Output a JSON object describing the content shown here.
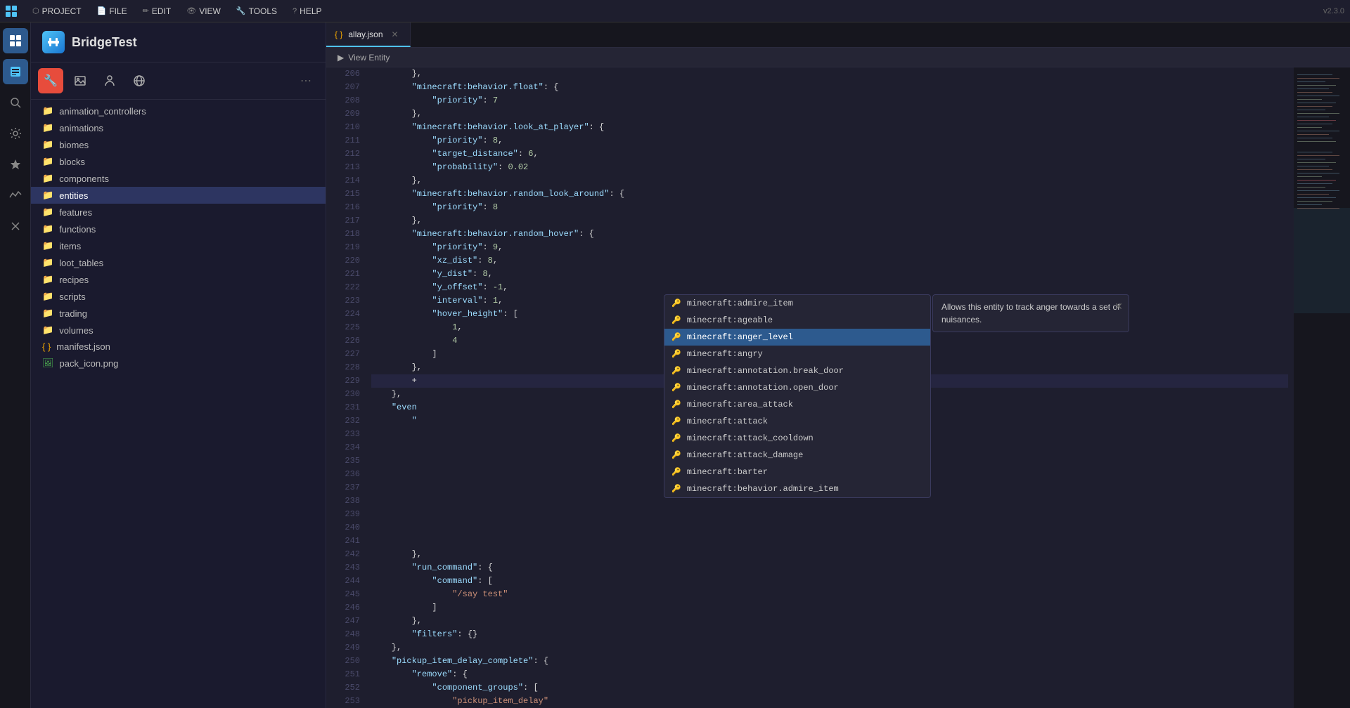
{
  "app": {
    "version": "v2.3.0",
    "title": "BridgeTest"
  },
  "menubar": {
    "items": [
      {
        "id": "project",
        "label": "PROJECT",
        "icon": "⬡"
      },
      {
        "id": "file",
        "label": "FILE",
        "icon": "📄"
      },
      {
        "id": "edit",
        "label": "EDIT",
        "icon": "✏️"
      },
      {
        "id": "view",
        "label": "VIEW",
        "icon": "👁"
      },
      {
        "id": "tools",
        "label": "TOOLS",
        "icon": "🔧"
      },
      {
        "id": "help",
        "label": "HELP",
        "icon": "?"
      }
    ]
  },
  "activity_bar": {
    "icons": [
      {
        "id": "grid",
        "symbol": "⊞",
        "active": true
      },
      {
        "id": "file-explorer",
        "symbol": "📁",
        "active": true
      },
      {
        "id": "search",
        "symbol": "🔍"
      },
      {
        "id": "settings",
        "symbol": "⚙"
      },
      {
        "id": "extensions",
        "symbol": "✦"
      },
      {
        "id": "signal",
        "symbol": "⌇"
      },
      {
        "id": "close",
        "symbol": "✕"
      }
    ]
  },
  "sidebar": {
    "title": "BridgeTest",
    "toolbar": {
      "wrench_btn": "🔧",
      "image_btn": "🖼",
      "person_btn": "🧍",
      "globe_btn": "🌐",
      "more_btn": "⋯"
    },
    "files": [
      {
        "name": "animation_controllers",
        "type": "folder"
      },
      {
        "name": "animations",
        "type": "folder"
      },
      {
        "name": "biomes",
        "type": "folder"
      },
      {
        "name": "blocks",
        "type": "folder"
      },
      {
        "name": "components",
        "type": "folder"
      },
      {
        "name": "entities",
        "type": "folder",
        "active": true
      },
      {
        "name": "features",
        "type": "folder"
      },
      {
        "name": "functions",
        "type": "folder"
      },
      {
        "name": "items",
        "type": "folder"
      },
      {
        "name": "loot_tables",
        "type": "folder"
      },
      {
        "name": "recipes",
        "type": "folder"
      },
      {
        "name": "scripts",
        "type": "folder"
      },
      {
        "name": "trading",
        "type": "folder"
      },
      {
        "name": "volumes",
        "type": "folder"
      },
      {
        "name": "manifest.json",
        "type": "json"
      },
      {
        "name": "pack_icon.png",
        "type": "png"
      }
    ]
  },
  "tab": {
    "filename": "allay.json",
    "icon": "{}",
    "close_btn": "✕"
  },
  "view_entity": {
    "label": "View Entity",
    "arrow": "▶"
  },
  "code": {
    "lines": [
      {
        "num": 206,
        "content": "        },"
      },
      {
        "num": 207,
        "content": "        \"minecraft:behavior.float\": {"
      },
      {
        "num": 208,
        "content": "            \"priority\": 7"
      },
      {
        "num": 209,
        "content": "        },"
      },
      {
        "num": 210,
        "content": "        \"minecraft:behavior.look_at_player\": {"
      },
      {
        "num": 211,
        "content": "            \"priority\": 8,"
      },
      {
        "num": 212,
        "content": "            \"target_distance\": 6,"
      },
      {
        "num": 213,
        "content": "            \"probability\": 0.02"
      },
      {
        "num": 214,
        "content": "        },"
      },
      {
        "num": 215,
        "content": "        \"minecraft:behavior.random_look_around\": {"
      },
      {
        "num": 216,
        "content": "            \"priority\": 8"
      },
      {
        "num": 217,
        "content": "        },"
      },
      {
        "num": 218,
        "content": "        \"minecraft:behavior.random_hover\": {"
      },
      {
        "num": 219,
        "content": "            \"priority\": 9,"
      },
      {
        "num": 220,
        "content": "            \"xz_dist\": 8,"
      },
      {
        "num": 221,
        "content": "            \"y_dist\": 8,"
      },
      {
        "num": 222,
        "content": "            \"y_offset\": -1,"
      },
      {
        "num": 223,
        "content": "            \"interval\": 1,"
      },
      {
        "num": 224,
        "content": "            \"hover_height\": ["
      },
      {
        "num": 225,
        "content": "                1,"
      },
      {
        "num": 226,
        "content": "                4"
      },
      {
        "num": 227,
        "content": "            ]"
      },
      {
        "num": 228,
        "content": "        },"
      },
      {
        "num": 229,
        "content": "        +"
      },
      {
        "num": 230,
        "content": "    },"
      },
      {
        "num": 231,
        "content": "    \"even"
      },
      {
        "num": 232,
        "content": "        \""
      },
      {
        "num": 233,
        "content": ""
      },
      {
        "num": 234,
        "content": ""
      },
      {
        "num": 235,
        "content": ""
      },
      {
        "num": 236,
        "content": ""
      },
      {
        "num": 237,
        "content": ""
      },
      {
        "num": 238,
        "content": ""
      },
      {
        "num": 239,
        "content": ""
      },
      {
        "num": 240,
        "content": ""
      },
      {
        "num": 241,
        "content": ""
      },
      {
        "num": 242,
        "content": "        },"
      },
      {
        "num": 243,
        "content": "        \"run_command\": {"
      },
      {
        "num": 244,
        "content": "            \"command\": ["
      },
      {
        "num": 245,
        "content": "                \"/say test\""
      },
      {
        "num": 246,
        "content": "            ]"
      },
      {
        "num": 247,
        "content": "        },"
      },
      {
        "num": 248,
        "content": "        \"filters\": {}"
      },
      {
        "num": 249,
        "content": "    },"
      },
      {
        "num": 250,
        "content": "    \"pickup_item_delay_complete\": {"
      },
      {
        "num": 251,
        "content": "        \"remove\": {"
      },
      {
        "num": 252,
        "content": "            \"component_groups\": ["
      },
      {
        "num": 253,
        "content": "                \"pickup_item_delay\""
      }
    ]
  },
  "autocomplete": {
    "items": [
      {
        "id": "admire-item",
        "label": "minecraft:admire_item"
      },
      {
        "id": "ageable",
        "label": "minecraft:ageable"
      },
      {
        "id": "anger-level",
        "label": "minecraft:anger_level",
        "selected": true
      },
      {
        "id": "angry",
        "label": "minecraft:angry"
      },
      {
        "id": "annotation-break-door",
        "label": "minecraft:annotation.break_door"
      },
      {
        "id": "annotation-open-door",
        "label": "minecraft:annotation.open_door"
      },
      {
        "id": "area-attack",
        "label": "minecraft:area_attack"
      },
      {
        "id": "attack",
        "label": "minecraft:attack"
      },
      {
        "id": "attack-cooldown",
        "label": "minecraft:attack_cooldown"
      },
      {
        "id": "attack-damage",
        "label": "minecraft:attack_damage"
      },
      {
        "id": "barter",
        "label": "minecraft:barter"
      },
      {
        "id": "behavior-admire-item",
        "label": "minecraft:behavior.admire_item"
      }
    ],
    "tooltip": {
      "text": "Allows this entity to track anger towards a set of nuisances.",
      "close_btn": "✕"
    }
  }
}
